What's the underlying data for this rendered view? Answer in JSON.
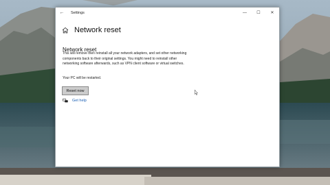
{
  "window": {
    "title": "Settings",
    "back_icon": "back-arrow-icon",
    "minimize_glyph": "—",
    "maximize_glyph": "☐",
    "close_glyph": "✕"
  },
  "page": {
    "title": "Network reset",
    "home_icon": "home-icon"
  },
  "section": {
    "title": "Network reset",
    "description": "This will remove then reinstall all your network adapters, and set other networking components back to their original settings. You might need to reinstall other networking software afterwards, such as VPN client software or virtual switches.",
    "restart_note": "Your PC will be restarted.",
    "reset_button": "Reset now"
  },
  "help": {
    "label": "Get help",
    "icon": "chat-bubbles-icon"
  },
  "colors": {
    "link": "#1a5fb4",
    "button_bg": "#cccccc",
    "window_bg": "#ffffff"
  }
}
